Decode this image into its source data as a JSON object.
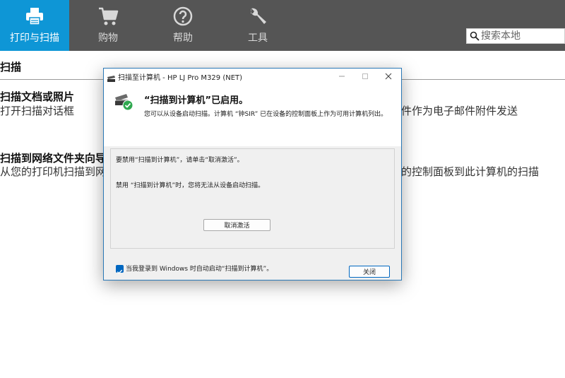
{
  "nav": {
    "items": [
      {
        "label": "打印与扫描",
        "icon": "printer-icon",
        "active": true
      },
      {
        "label": "购物",
        "icon": "shopping-cart-icon",
        "active": false
      },
      {
        "label": "帮助",
        "icon": "help-icon",
        "active": false
      },
      {
        "label": "工具",
        "icon": "wrench-icon",
        "active": false
      }
    ],
    "search_placeholder": "搜索本地"
  },
  "page": {
    "section_title": "扫描",
    "items": [
      {
        "title": "扫描文档或照片",
        "desc_left": "打开扫描对话框",
        "desc_right": "件作为电子邮件附件发送"
      },
      {
        "title": "扫描到网络文件夹向导",
        "desc_left": "从您的打印机扫描到网络",
        "desc_right": "的控制面板到此计算机的扫描"
      }
    ]
  },
  "dialog": {
    "title": "扫描至计算机 - HP LJ Pro M329 (NET)",
    "heading": "“扫描到计算机”已启用。",
    "subtext": "您可以从设备启动扫描。计算机 “钟SIR” 已在设备的控制面板上作为可用计算机列出。",
    "line1": "要禁用“扫描到计算机”，请单击“取消激活”。",
    "line2": "禁用 “扫描到计算机”时，您将无法从设备启动扫描。",
    "deactivate_label": "取消激活",
    "checkbox_label": "当我登录到 Windows 时自动启动“扫描到计算机”。",
    "checkbox_checked": true,
    "close_label": "关闭",
    "accent_color": "#0067c0"
  },
  "colors": {
    "topbar": "#555555",
    "active_tab": "#0e96d6"
  }
}
